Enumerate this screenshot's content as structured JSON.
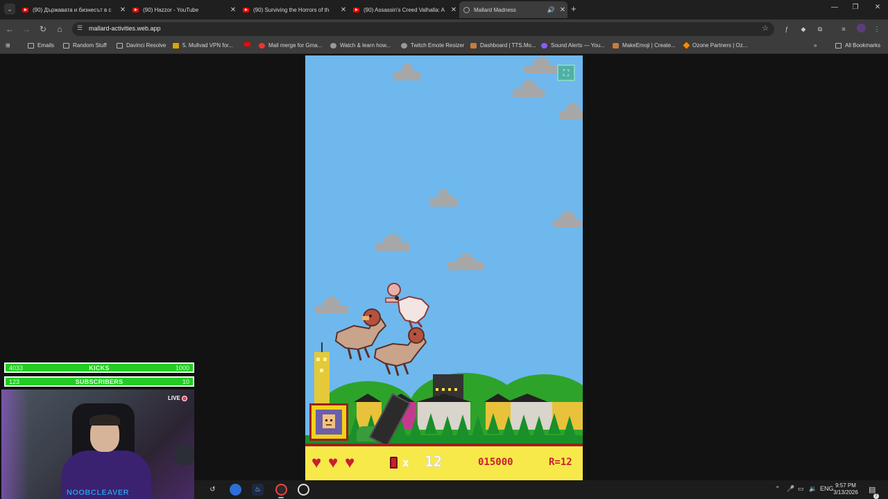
{
  "browser": {
    "tabs": [
      {
        "label": "(90) Държавата и бизнесът в с",
        "icon": "youtube-icon"
      },
      {
        "label": "(90) Hazzor - YouTube",
        "icon": "youtube-icon"
      },
      {
        "label": "(90) Surviving the Horrors of th",
        "icon": "youtube-icon"
      },
      {
        "label": "(90) Assassin's Creed Valhalla: A",
        "icon": "youtube-icon"
      },
      {
        "label": "Mallard Madness",
        "icon": "globe-icon",
        "active": true
      }
    ],
    "url": "mallard-activities.web.app",
    "bookmarks": [
      {
        "label": "Emails",
        "icon": "folder-icon"
      },
      {
        "label": "Random Stuff",
        "icon": "folder-icon"
      },
      {
        "label": "Davinci Resolve",
        "icon": "folder-icon"
      },
      {
        "label": "5. Mullvad VPN for...",
        "icon": "mullvad-icon"
      },
      {
        "label": "",
        "icon": "youtube-icon"
      },
      {
        "label": "Mail merge for Gma...",
        "icon": "mailmerge-icon"
      },
      {
        "label": "Watch & learn how...",
        "icon": "camera-icon"
      },
      {
        "label": "Twitch Emote Resizer",
        "icon": "twitch-emote-icon"
      },
      {
        "label": "Dashboard | TTS.Mo...",
        "icon": "tts-icon"
      },
      {
        "label": "Sound Alerts — You...",
        "icon": "soundalerts-icon"
      },
      {
        "label": "MakeEmoji | Create...",
        "icon": "makeemoji-icon"
      },
      {
        "label": "Ozone Partners | Oz...",
        "icon": "ozone-icon"
      }
    ],
    "all_bookmarks": "All Bookmarks",
    "more_bookmarks": "»"
  },
  "game": {
    "hud": {
      "lives": 3,
      "times": "x",
      "ammo": "12",
      "score": "015000",
      "round": "R=12"
    },
    "colors": {
      "sky": "#6eb8ee",
      "hud": "#f7e94a",
      "accent": "#c8202e"
    }
  },
  "overlay": {
    "kicks": {
      "current": "4033",
      "label": "KICKS",
      "goal": "1000"
    },
    "subs": {
      "current": "123",
      "label": "SUBSCRIBERS",
      "goal": "10"
    },
    "live": "LIVE",
    "name": "NOOBCLEAVER"
  },
  "taskbar": {
    "lang": "ENG",
    "time": "9:57 PM",
    "date": "3/13/2026",
    "notifications": "7"
  }
}
